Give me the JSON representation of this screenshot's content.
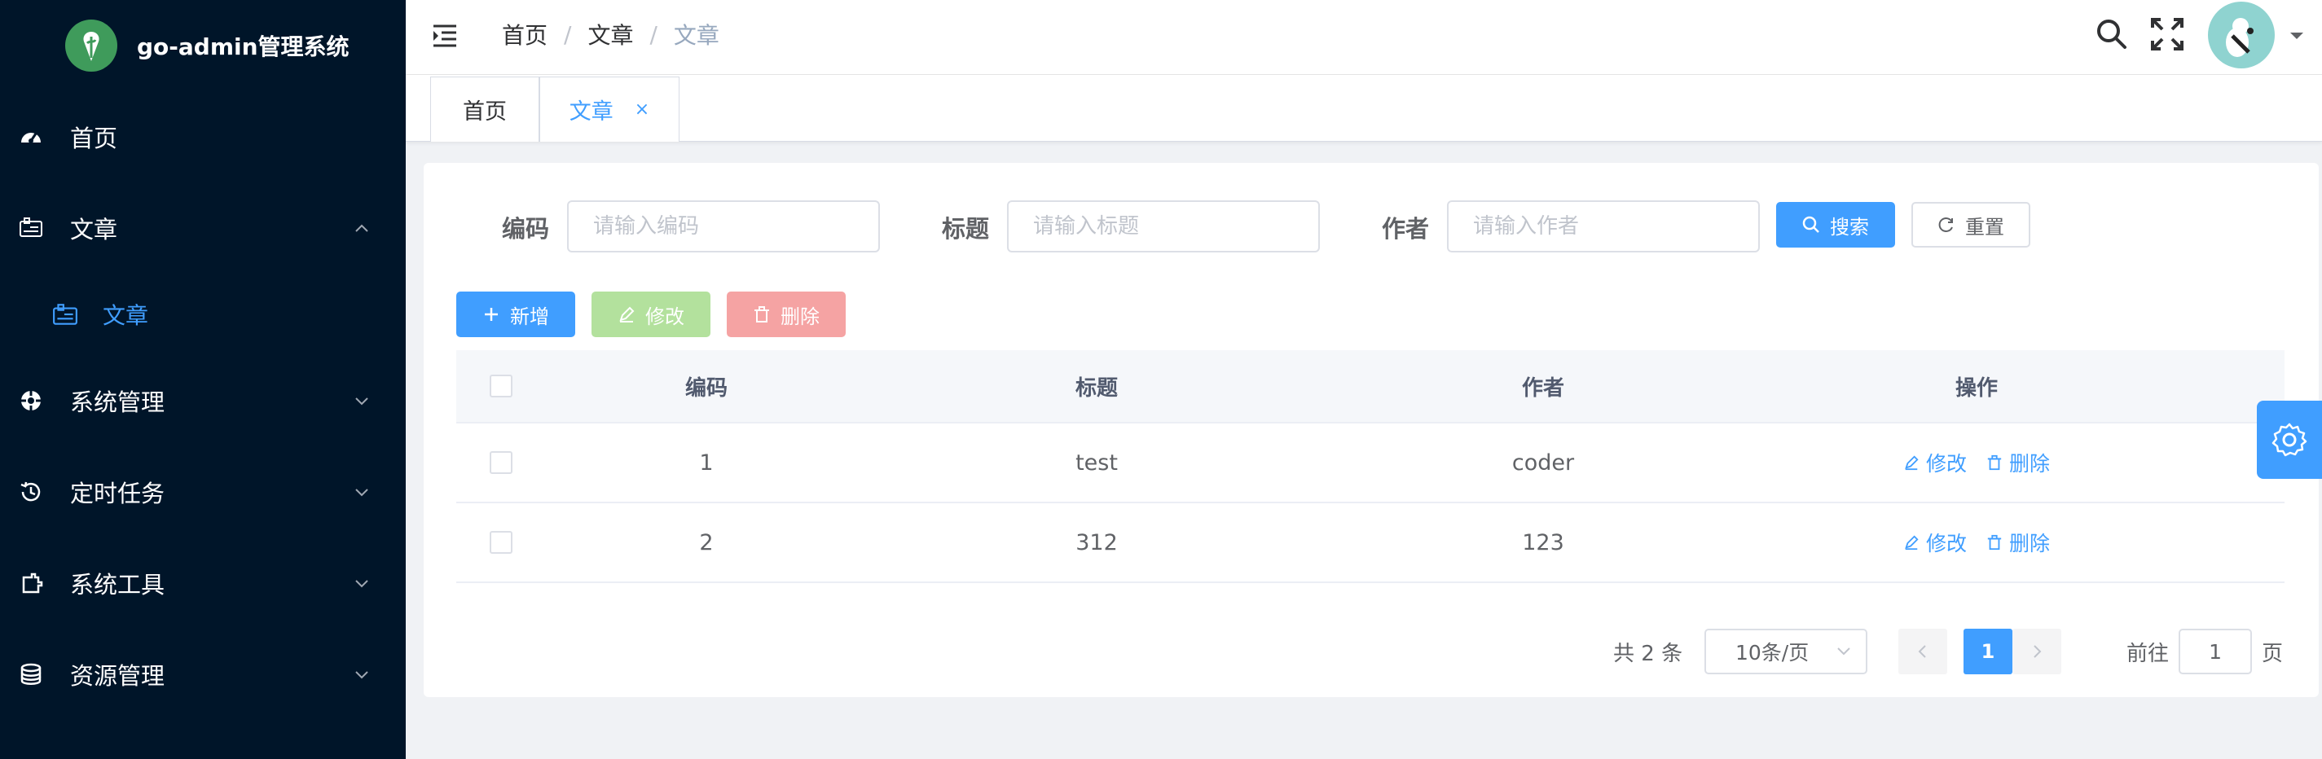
{
  "app": {
    "title": "go-admin管理系统"
  },
  "sidebar": {
    "items": [
      {
        "label": "首页",
        "icon": "dashboard-icon"
      },
      {
        "label": "文章",
        "icon": "article-icon",
        "expanded": true,
        "children": [
          {
            "label": "文章",
            "icon": "article-icon",
            "active": true
          }
        ]
      },
      {
        "label": "系统管理",
        "icon": "system-icon",
        "expanded": false
      },
      {
        "label": "定时任务",
        "icon": "schedule-icon",
        "expanded": false
      },
      {
        "label": "系统工具",
        "icon": "tools-icon",
        "expanded": false
      },
      {
        "label": "资源管理",
        "icon": "database-icon",
        "expanded": false
      }
    ]
  },
  "header": {
    "breadcrumb": [
      "首页",
      "文章",
      "文章"
    ]
  },
  "tabs": [
    {
      "label": "首页",
      "active": false
    },
    {
      "label": "文章",
      "active": true,
      "closable": true,
      "close_label": "×"
    }
  ],
  "filters": {
    "code": {
      "label": "编码",
      "placeholder": "请输入编码",
      "value": ""
    },
    "title": {
      "label": "标题",
      "placeholder": "请输入标题",
      "value": ""
    },
    "author": {
      "label": "作者",
      "placeholder": "请输入作者",
      "value": ""
    },
    "search_label": "搜索",
    "reset_label": "重置"
  },
  "toolbar": {
    "add_label": "新增",
    "edit_label": "修改",
    "delete_label": "删除"
  },
  "table": {
    "columns": [
      "编码",
      "标题",
      "作者",
      "操作"
    ],
    "rows": [
      {
        "code": "1",
        "title": "test",
        "author": "coder"
      },
      {
        "code": "2",
        "title": "312",
        "author": "123"
      }
    ],
    "row_actions": {
      "edit": "修改",
      "delete": "删除"
    }
  },
  "pagination": {
    "total_text": "共 2 条",
    "page_size": "10条/页",
    "current_page": "1",
    "goto_prefix": "前往",
    "goto_value": "1",
    "goto_suffix": "页"
  },
  "colors": {
    "sidebar_bg": "#001529",
    "primary": "#409eff",
    "edit_disabled": "#b3e19d",
    "delete_disabled": "#f5a3a3"
  }
}
